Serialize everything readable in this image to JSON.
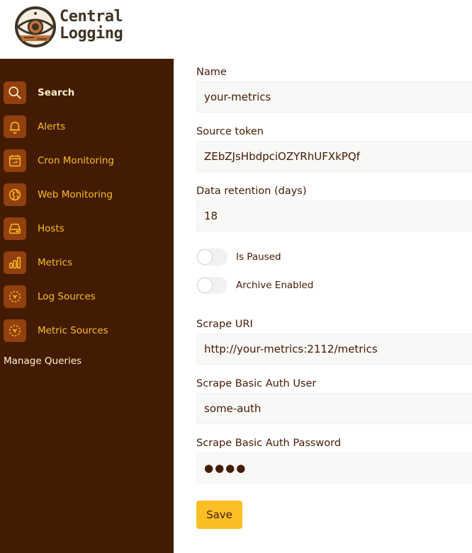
{
  "app": {
    "title_line1": "Central",
    "title_line2": "Logging"
  },
  "sidebar": {
    "items": [
      {
        "label": "Search",
        "icon": "search-icon",
        "active": true
      },
      {
        "label": "Alerts",
        "icon": "bell-icon",
        "active": false
      },
      {
        "label": "Cron Monitoring",
        "icon": "calendar-icon",
        "active": false
      },
      {
        "label": "Web Monitoring",
        "icon": "globe-icon",
        "active": false
      },
      {
        "label": "Hosts",
        "icon": "server-icon",
        "active": false
      },
      {
        "label": "Metrics",
        "icon": "bar-chart-icon",
        "active": false
      },
      {
        "label": "Log Sources",
        "icon": "sources-icon",
        "active": false
      },
      {
        "label": "Metric Sources",
        "icon": "sources-icon",
        "active": false
      }
    ],
    "manage_queries": "Manage Queries"
  },
  "form": {
    "name": {
      "label": "Name",
      "value": "your-metrics"
    },
    "source_token": {
      "label": "Source token",
      "value": "ZEbZJsHbdpciOZYRhUFXkPQf"
    },
    "retention": {
      "label": "Data retention (days)",
      "value": "18"
    },
    "is_paused": {
      "label": "Is Paused",
      "checked": false
    },
    "archive_enabled": {
      "label": "Archive Enabled",
      "checked": false
    },
    "scrape_uri": {
      "label": "Scrape URI",
      "value": "http://your-metrics:2112/metrics"
    },
    "auth_user": {
      "label": "Scrape Basic Auth User",
      "value": "some-auth"
    },
    "auth_password": {
      "label": "Scrape Basic Auth Password",
      "value": "●●●●"
    },
    "save_label": "Save"
  },
  "colors": {
    "sidebar_bg": "#421b02",
    "icon_bg": "#92400e",
    "accent": "#fbbf24",
    "text": "#451a03"
  }
}
